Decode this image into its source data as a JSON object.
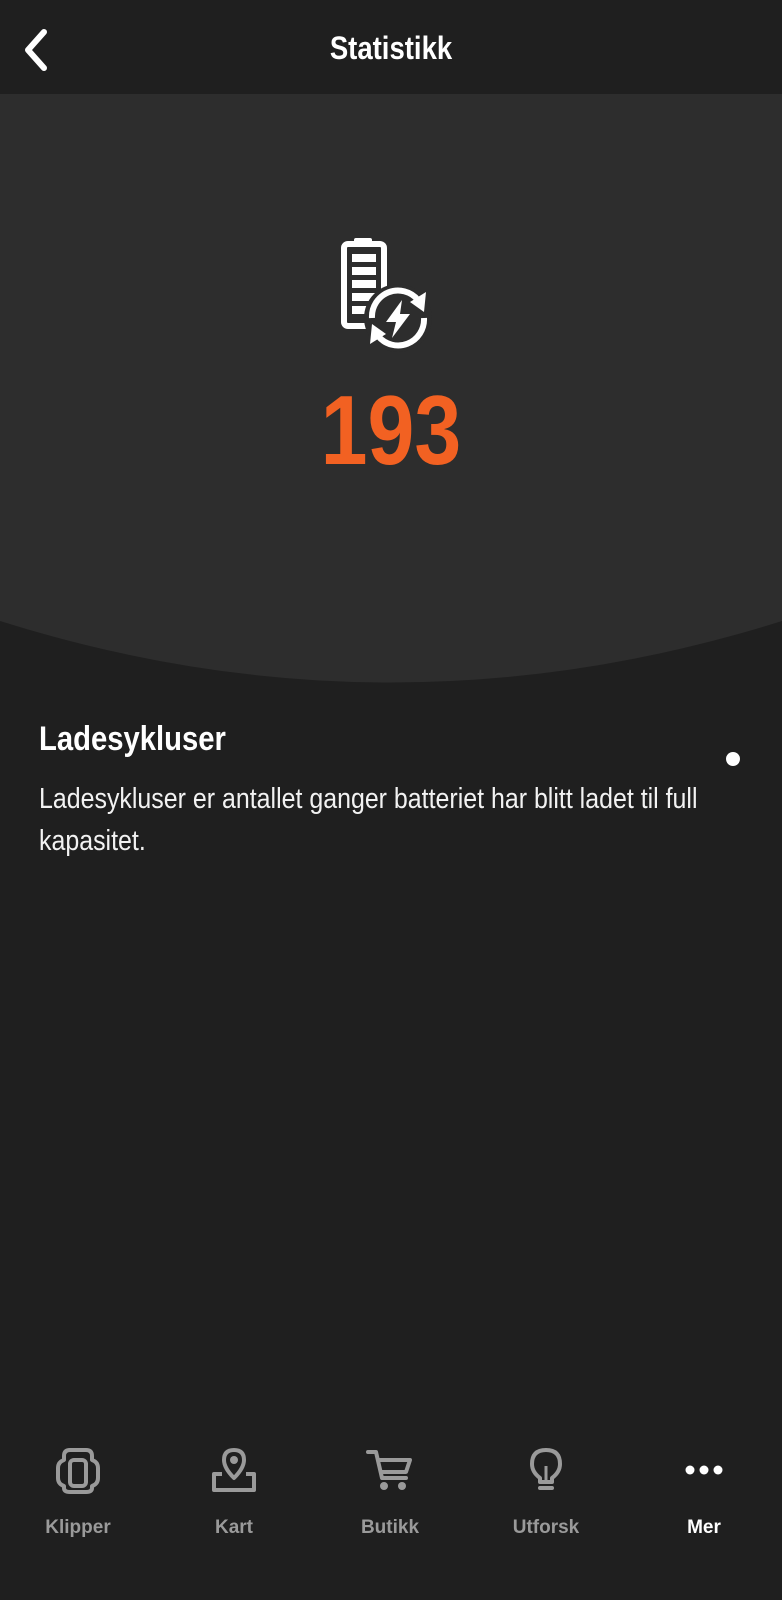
{
  "header": {
    "title": "Statistikk"
  },
  "stat": {
    "value": "193"
  },
  "info": {
    "title": "Ladesykluser",
    "description": "Ladesykluser er antallet ganger batteriet har blitt ladet til full kapasitet."
  },
  "tabs": [
    {
      "label": "Klipper",
      "icon": "mower-icon",
      "active": false
    },
    {
      "label": "Kart",
      "icon": "map-pin-icon",
      "active": false
    },
    {
      "label": "Butikk",
      "icon": "cart-icon",
      "active": false
    },
    {
      "label": "Utforsk",
      "icon": "lightbulb-icon",
      "active": false
    },
    {
      "label": "Mer",
      "icon": "more-dots-icon",
      "active": true
    }
  ],
  "colors": {
    "accent": "#f26122",
    "background": "#1f1f1f",
    "hero_background": "#2d2d2d",
    "inactive_tab": "#9a9a9a"
  }
}
